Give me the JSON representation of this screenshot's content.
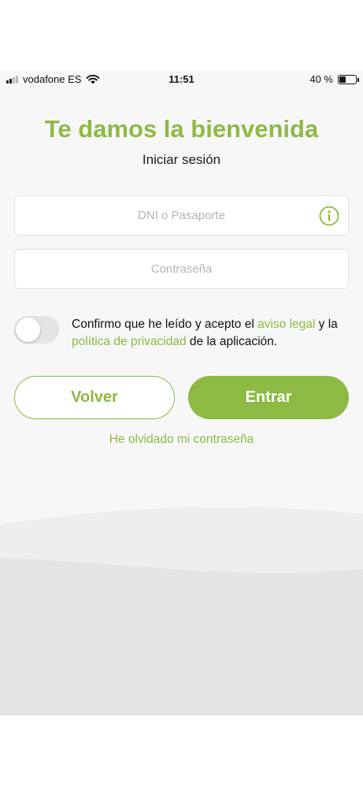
{
  "status_bar": {
    "carrier": "vodafone ES",
    "time": "11:51",
    "battery_text": "40 %",
    "battery_level": 0.4
  },
  "login": {
    "title": "Te damos la bienvenida",
    "subtitle": "Iniciar sesión",
    "dni_placeholder": "DNI o Pasaporte",
    "password_placeholder": "Contraseña",
    "consent": {
      "text_1": "Confirmo que he leído y acepto el ",
      "legal_link": "aviso legal",
      "text_2": " y la ",
      "privacy_link": "política de privacidad",
      "text_3": " de la aplicación.",
      "accepted": false
    },
    "back_button": "Volver",
    "enter_button": "Entrar",
    "forgot_password": "He olvidado mi contraseña"
  },
  "colors": {
    "accent": "#8dba43",
    "background": "#f7f7f8",
    "wave": "#e4e4e6"
  }
}
